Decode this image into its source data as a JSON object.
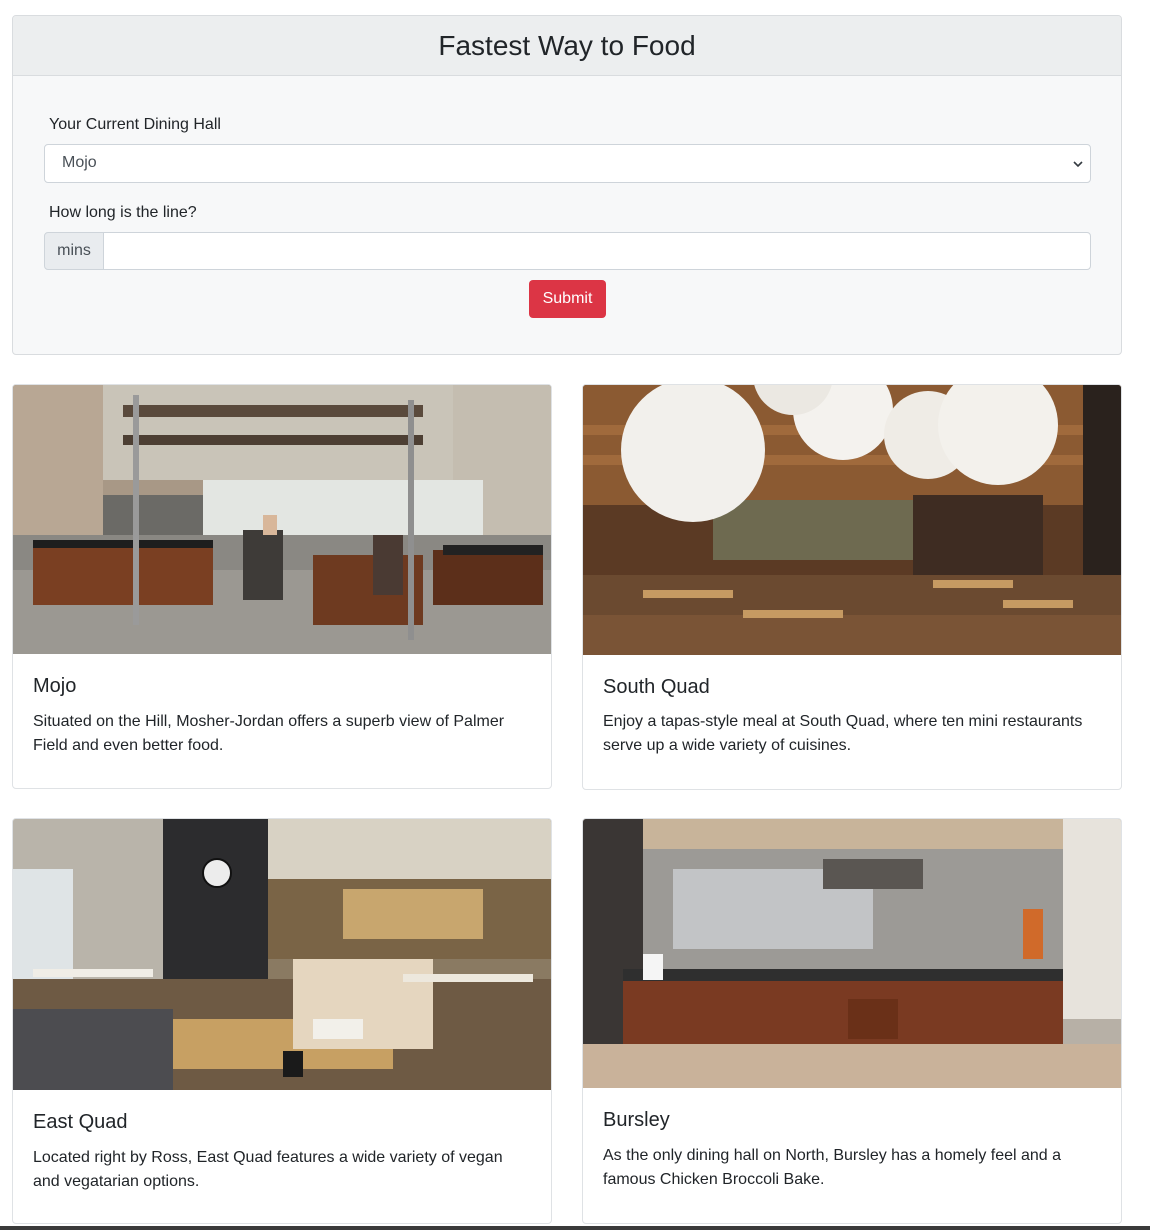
{
  "form": {
    "title": "Fastest Way to Food",
    "hall_label": "Your Current Dining Hall",
    "hall_selected": "Mojo",
    "line_label": "How long is the line?",
    "line_addon": "mins",
    "line_value": "",
    "submit_label": "Submit"
  },
  "cards": [
    {
      "title": "Mojo",
      "text": "Situated on the Hill, Mosher-Jordan offers a superb view of Palmer Field and even better food."
    },
    {
      "title": "South Quad",
      "text": "Enjoy a tapas-style meal at South Quad, where ten mini restaurants serve up a wide variety of cuisines."
    },
    {
      "title": "East Quad",
      "text": "Located right by Ross, East Quad features a wide variety of vegan and vegatarian options."
    },
    {
      "title": "Bursley",
      "text": "As the only dining hall on North, Bursley has a homely feel and a famous Chicken Broccoli Bake."
    }
  ],
  "colors": {
    "submit": "#dc3545",
    "header_bg": "#eceeef",
    "addon_bg": "#e9ecef"
  }
}
